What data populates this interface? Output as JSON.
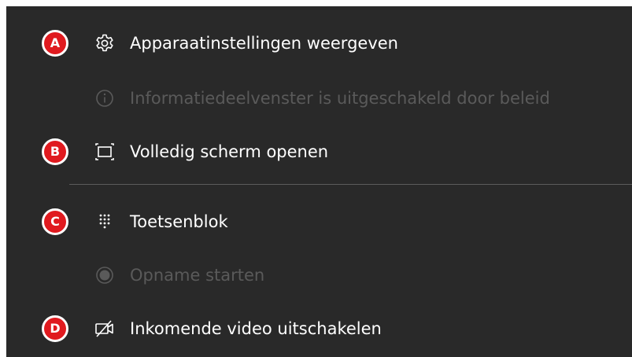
{
  "menu": {
    "items": [
      {
        "label": "Apparaatinstellingen weergeven",
        "icon": "gear-icon",
        "badge": "A",
        "enabled": true
      },
      {
        "label": "Informatiedeelvenster is uitgeschakeld door beleid",
        "icon": "info-icon",
        "badge": "",
        "enabled": false
      },
      {
        "label": "Volledig scherm openen",
        "icon": "fullscreen-icon",
        "badge": "B",
        "enabled": true
      },
      {
        "label": "Toetsenblok",
        "icon": "dialpad-icon",
        "badge": "C",
        "enabled": true
      },
      {
        "label": "Opname starten",
        "icon": "record-icon",
        "badge": "",
        "enabled": false
      },
      {
        "label": "Inkomende video uitschakelen",
        "icon": "video-off-icon",
        "badge": "D",
        "enabled": true
      }
    ]
  },
  "colors": {
    "background": "#292929",
    "text": "#ffffff",
    "disabled_text": "#5a5a5a",
    "badge": "#e01a1f",
    "divider": "#5b5b5b"
  }
}
